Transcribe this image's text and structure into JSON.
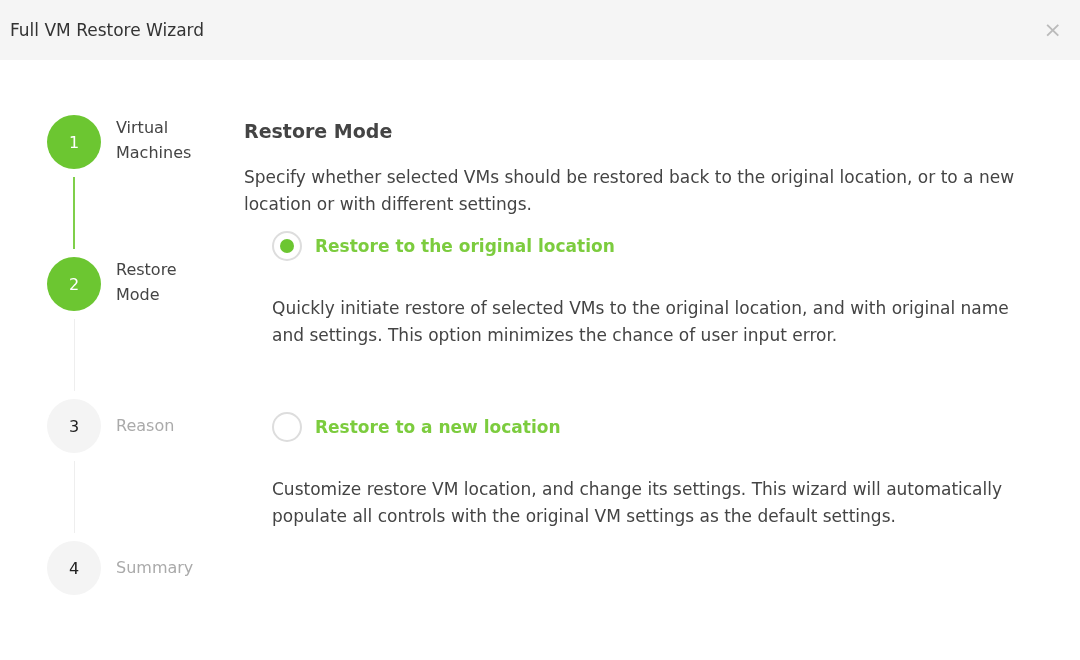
{
  "window": {
    "title": "Full VM Restore Wizard",
    "close": "×"
  },
  "steps": [
    {
      "number": "1",
      "label": "Virtual Machines",
      "completed": true
    },
    {
      "number": "2",
      "label": "Restore Mode",
      "completed": true
    },
    {
      "number": "3",
      "label": "Reason",
      "completed": false
    },
    {
      "number": "4",
      "label": "Summary",
      "completed": false
    }
  ],
  "heading": "Restore Mode",
  "description": "Specify whether selected VMs should be restored back to the original location, or to a new location or with different settings.",
  "options": [
    {
      "label": "Restore to the original location",
      "selected": true,
      "description": "Quickly initiate restore of selected VMs to the original location, and with original name and settings. This option minimizes the chance of user input error."
    },
    {
      "label": "Restore to a new location",
      "selected": false,
      "description": "Customize restore VM location, and change its settings. This wizard will automatically populate all controls with the original VM settings as the default settings."
    }
  ]
}
